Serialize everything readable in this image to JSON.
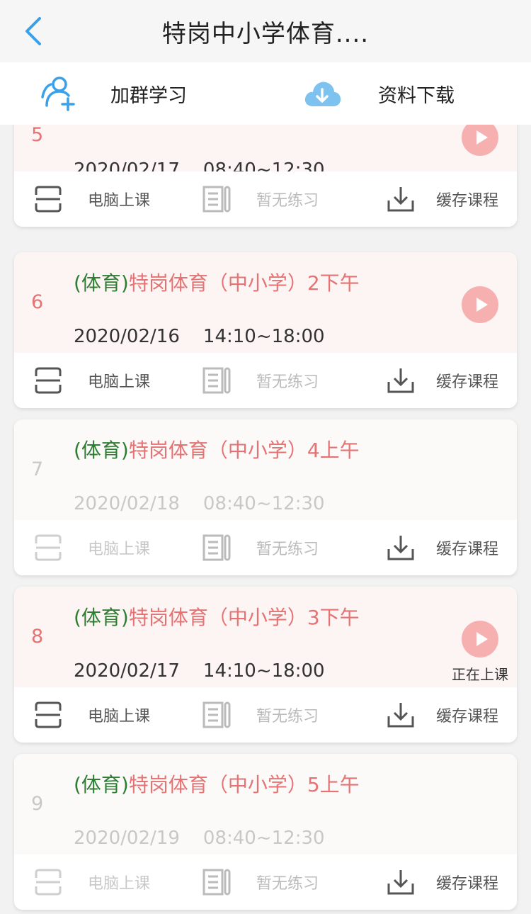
{
  "header": {
    "title": "特岗中小学体育...."
  },
  "actions": {
    "join_group": "加群学习",
    "download": "资料下载"
  },
  "labels": {
    "pc_class": "电脑上课",
    "no_practice": "暂无练习",
    "cache": "缓存课程",
    "in_class": "正在上课"
  },
  "lessons": [
    {
      "num": "5",
      "category": "",
      "name": "",
      "date": "2020/02/17",
      "time": "08:40~12:30",
      "state": "active"
    },
    {
      "num": "6",
      "category": "(体育)",
      "name": "特岗体育（中小学）2下午",
      "date": "2020/02/16",
      "time": "14:10~18:00",
      "state": "active"
    },
    {
      "num": "7",
      "category": "(体育)",
      "name": "特岗体育（中小学）4上午",
      "date": "2020/02/18",
      "time": "08:40~12:30",
      "state": "locked"
    },
    {
      "num": "8",
      "category": "(体育)",
      "name": "特岗体育（中小学）3下午",
      "date": "2020/02/17",
      "time": "14:10~18:00",
      "state": "live"
    },
    {
      "num": "9",
      "category": "(体育)",
      "name": "特岗体育（中小学）5上午",
      "date": "2020/02/19",
      "time": "08:40~12:30",
      "state": "locked"
    }
  ],
  "colors": {
    "accent": "#3aa0e8",
    "lesson_red": "#e57373",
    "category_green": "#2e7d32",
    "play_pink": "#f7b0b0"
  }
}
